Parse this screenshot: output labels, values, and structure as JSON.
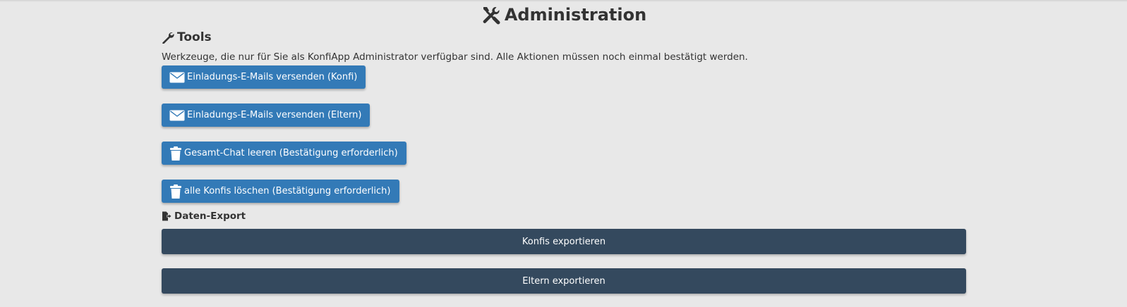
{
  "page": {
    "title": "Administration",
    "title_icon": "tools-icon"
  },
  "tools": {
    "heading": "Tools",
    "heading_icon": "wrench-icon",
    "description": "Werkzeuge, die nur für Sie als KonfiApp Administrator verfügbar sind. Alle Aktionen müssen noch einmal bestätigt werden.",
    "buttons": [
      {
        "label": "Einladungs-E-Mails versenden (Konfi)",
        "icon": "envelope-icon"
      },
      {
        "label": "Einladungs-E-Mails versenden (Eltern)",
        "icon": "envelope-icon"
      },
      {
        "label": "Gesamt-Chat leeren (Bestätigung erforderlich)",
        "icon": "trash-icon"
      },
      {
        "label": "alle Konfis löschen (Bestätigung erforderlich)",
        "icon": "trash-icon"
      }
    ]
  },
  "export": {
    "heading": "Daten-Export",
    "heading_icon": "file-export-icon",
    "buttons": [
      {
        "label": "Konfis exportieren"
      },
      {
        "label": "Eltern exportieren"
      }
    ]
  },
  "colors": {
    "background": "#e8e8e8",
    "primary_button": "#337ab7",
    "export_button": "#34495e",
    "text": "#333333"
  }
}
